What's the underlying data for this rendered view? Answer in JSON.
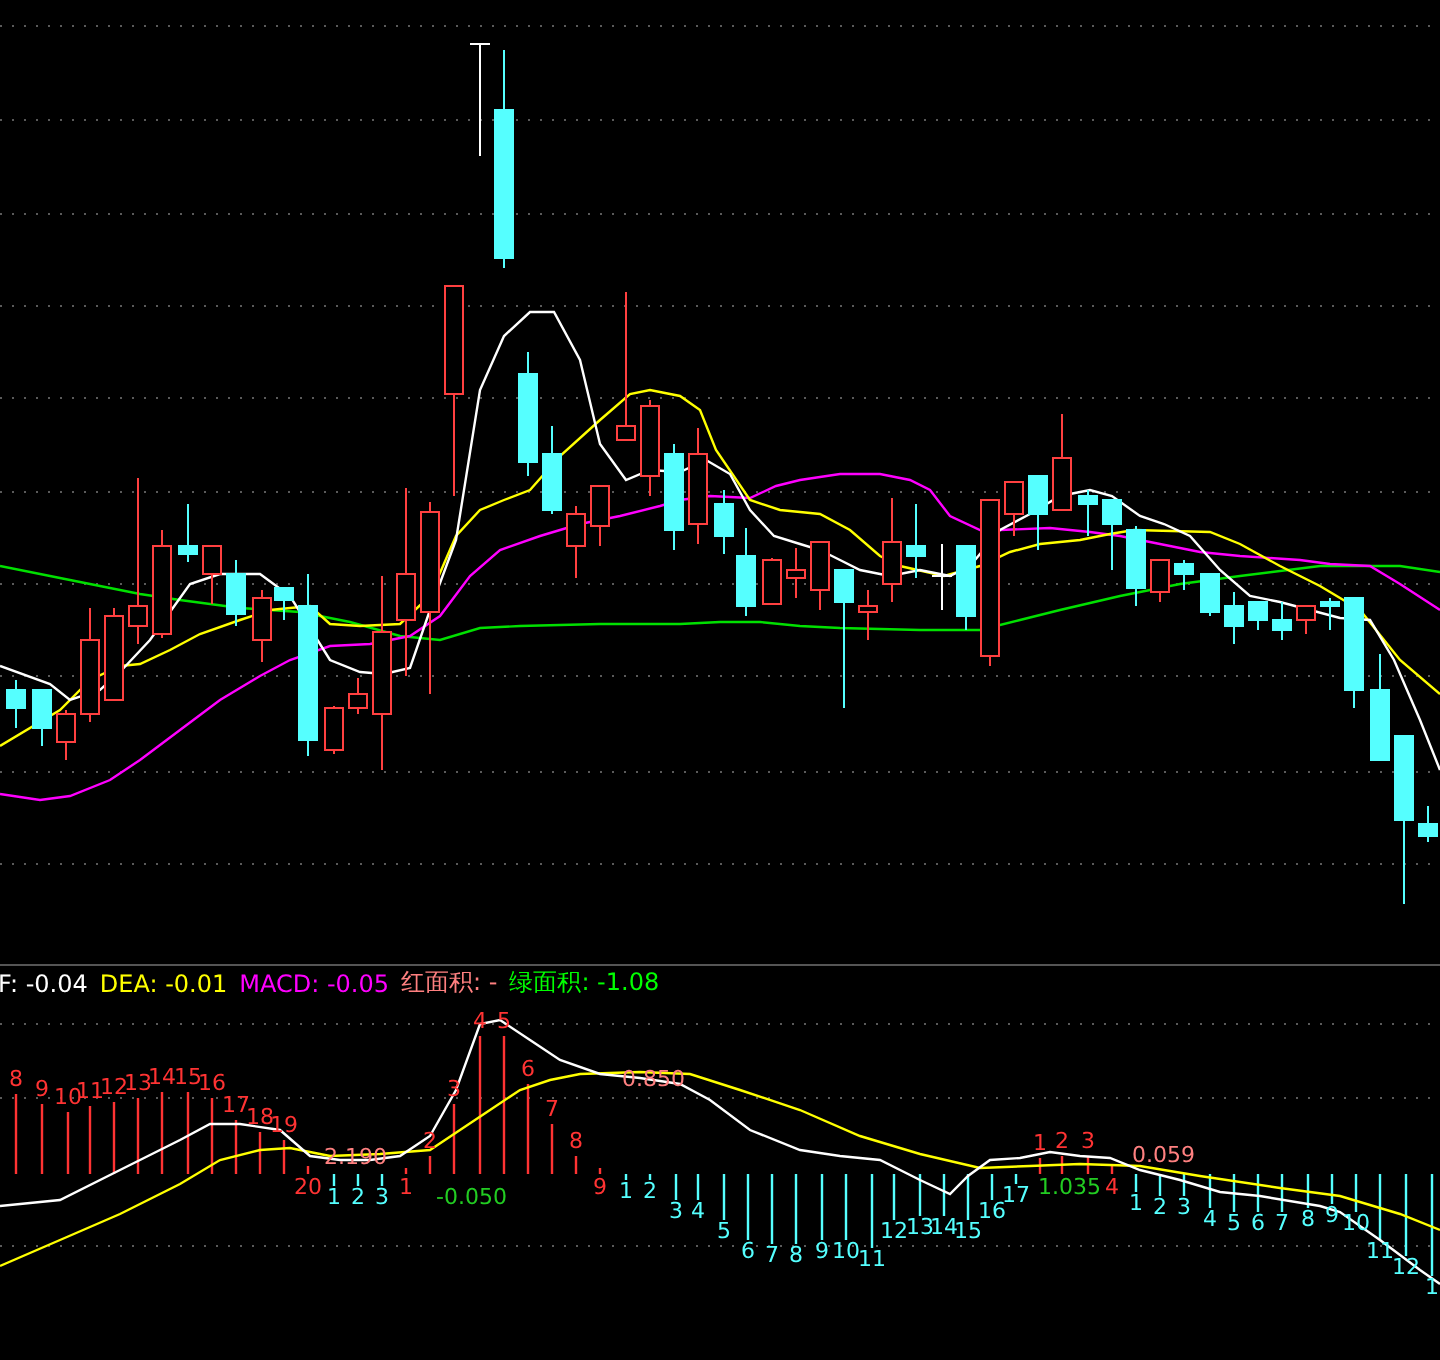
{
  "indicator_values": [
    {
      "text": "F: -0.04",
      "color": "#ffffff"
    },
    {
      "text": "DEA: -0.01",
      "color": "#ffff00"
    },
    {
      "text": "MACD: -0.05",
      "color": "#ff00ff"
    },
    {
      "text": "红面积: -",
      "color": "#ff8080"
    },
    {
      "text": "绿面积: -1.08",
      "color": "#00ff00"
    }
  ],
  "area_labels": [
    {
      "text": "2.190",
      "kind": "red"
    },
    {
      "text": "-0.050",
      "kind": "green"
    },
    {
      "text": "0.850",
      "kind": "red"
    },
    {
      "text": "1.035",
      "kind": "green"
    },
    {
      "text": "0.059",
      "kind": "red"
    }
  ],
  "bar_counts": [
    {
      "text": "8",
      "kind": "up"
    },
    {
      "text": "9",
      "kind": "up"
    },
    {
      "text": "10",
      "kind": "up"
    },
    {
      "text": "11",
      "kind": "up"
    },
    {
      "text": "12",
      "kind": "up"
    },
    {
      "text": "13",
      "kind": "up"
    },
    {
      "text": "14",
      "kind": "up"
    },
    {
      "text": "15",
      "kind": "up"
    },
    {
      "text": "16",
      "kind": "up"
    },
    {
      "text": "17",
      "kind": "up"
    },
    {
      "text": "18",
      "kind": "up"
    },
    {
      "text": "19",
      "kind": "up"
    },
    {
      "text": "20",
      "kind": "up"
    },
    {
      "text": "1",
      "kind": "down"
    },
    {
      "text": "2",
      "kind": "down"
    },
    {
      "text": "3",
      "kind": "down"
    },
    {
      "text": "1",
      "kind": "up"
    },
    {
      "text": "2",
      "kind": "up"
    },
    {
      "text": "3",
      "kind": "up"
    },
    {
      "text": "4",
      "kind": "up"
    },
    {
      "text": "5",
      "kind": "up"
    },
    {
      "text": "6",
      "kind": "up"
    },
    {
      "text": "7",
      "kind": "up"
    },
    {
      "text": "8",
      "kind": "up"
    },
    {
      "text": "9",
      "kind": "up"
    },
    {
      "text": "1",
      "kind": "down"
    },
    {
      "text": "2",
      "kind": "down"
    },
    {
      "text": "3",
      "kind": "down"
    },
    {
      "text": "4",
      "kind": "down"
    },
    {
      "text": "5",
      "kind": "down"
    },
    {
      "text": "6",
      "kind": "down"
    },
    {
      "text": "7",
      "kind": "down"
    },
    {
      "text": "8",
      "kind": "down"
    },
    {
      "text": "9",
      "kind": "down"
    },
    {
      "text": "10",
      "kind": "down"
    },
    {
      "text": "11",
      "kind": "down"
    },
    {
      "text": "12",
      "kind": "down"
    },
    {
      "text": "13",
      "kind": "down"
    },
    {
      "text": "14",
      "kind": "down"
    },
    {
      "text": "15",
      "kind": "down"
    },
    {
      "text": "16",
      "kind": "down"
    },
    {
      "text": "17",
      "kind": "down"
    },
    {
      "text": "1",
      "kind": "up"
    },
    {
      "text": "2",
      "kind": "up"
    },
    {
      "text": "3",
      "kind": "up"
    },
    {
      "text": "4",
      "kind": "up"
    },
    {
      "text": "1",
      "kind": "down"
    },
    {
      "text": "2",
      "kind": "down"
    },
    {
      "text": "3",
      "kind": "down"
    },
    {
      "text": "4",
      "kind": "down"
    },
    {
      "text": "5",
      "kind": "down"
    },
    {
      "text": "6",
      "kind": "down"
    },
    {
      "text": "7",
      "kind": "down"
    },
    {
      "text": "8",
      "kind": "down"
    },
    {
      "text": "9",
      "kind": "down"
    },
    {
      "text": "10",
      "kind": "down"
    },
    {
      "text": "11",
      "kind": "down"
    },
    {
      "text": "12",
      "kind": "down"
    },
    {
      "text": "1",
      "kind": "down"
    }
  ]
}
